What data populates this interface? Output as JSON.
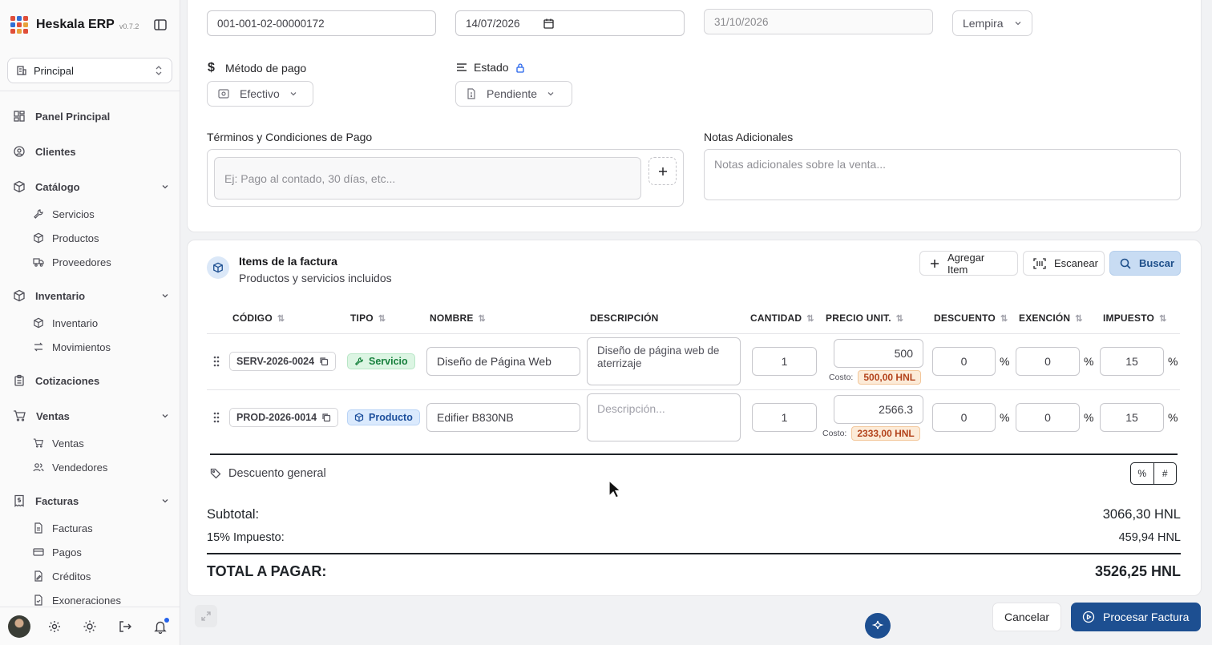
{
  "app": {
    "name": "Heskala ERP",
    "version": "v0.7.2"
  },
  "branch": {
    "label": "Principal"
  },
  "nav": {
    "panel": "Panel Principal",
    "clientes": "Clientes",
    "catalogo": "Catálogo",
    "catalogo_items": [
      "Servicios",
      "Productos",
      "Proveedores"
    ],
    "inventario": "Inventario",
    "inventario_items": [
      "Inventario",
      "Movimientos"
    ],
    "cotizaciones": "Cotizaciones",
    "ventas": "Ventas",
    "ventas_items": [
      "Ventas",
      "Vendedores"
    ],
    "facturas": "Facturas",
    "facturas_items": [
      "Facturas",
      "Pagos",
      "Créditos",
      "Exoneraciones"
    ]
  },
  "form": {
    "invoice_number": "001-001-02-00000172",
    "issue_date": "14/07/2026",
    "due_date": "31/10/2026",
    "currency": "Lempira",
    "payment_method_label": "Método de pago",
    "payment_method_value": "Efectivo",
    "status_label": "Estado",
    "status_value": "Pendiente",
    "terms_label": "Términos y Condiciones de Pago",
    "terms_placeholder": "Ej: Pago al contado, 30 días, etc...",
    "notes_label": "Notas Adicionales",
    "notes_placeholder": "Notas adicionales sobre la venta..."
  },
  "items": {
    "title": "Items de la factura",
    "subtitle": "Productos y servicios incluidos",
    "actions": {
      "add": "Agregar Item",
      "scan": "Escanear",
      "search": "Buscar"
    },
    "headers": [
      "CÓDIGO",
      "TIPO",
      "NOMBRE",
      "DESCRIPCIÓN",
      "CANTIDAD",
      "PRECIO UNIT.",
      "DESCUENTO",
      "EXENCIÓN",
      "IMPUESTO"
    ],
    "rows": [
      {
        "code": "SERV-2026-0024",
        "type": "Servicio",
        "name": "Diseño de Página Web",
        "description": "Diseño de página web de aterrizaje",
        "quantity": "1",
        "price": "500",
        "cost_label": "Costo:",
        "cost": "500,00 HNL",
        "discount": "0",
        "exemption": "0",
        "tax": "15"
      },
      {
        "code": "PROD-2026-0014",
        "type": "Producto",
        "name": "Edifier B830NB",
        "description_placeholder": "Descripción...",
        "quantity": "1",
        "price": "2566.3",
        "cost_label": "Costo:",
        "cost": "2333,00 HNL",
        "discount": "0",
        "exemption": "0",
        "tax": "15"
      }
    ],
    "percent_sign": "%"
  },
  "discount": {
    "label": "Descuento general",
    "opt_percent": "%",
    "opt_fixed": "#"
  },
  "totals": {
    "subtotal_label": "Subtotal:",
    "subtotal_value": "3066,30 HNL",
    "tax_label": "15% Impuesto:",
    "tax_value": "459,94 HNL",
    "total_label": "TOTAL A PAGAR:",
    "total_value": "3526,25 HNL"
  },
  "footer": {
    "cancel": "Cancelar",
    "process": "Procesar Factura"
  },
  "colors": {
    "accent": "#1d4f91",
    "brand_red": "#e04e39",
    "cost_badge": "#fcebd8"
  }
}
